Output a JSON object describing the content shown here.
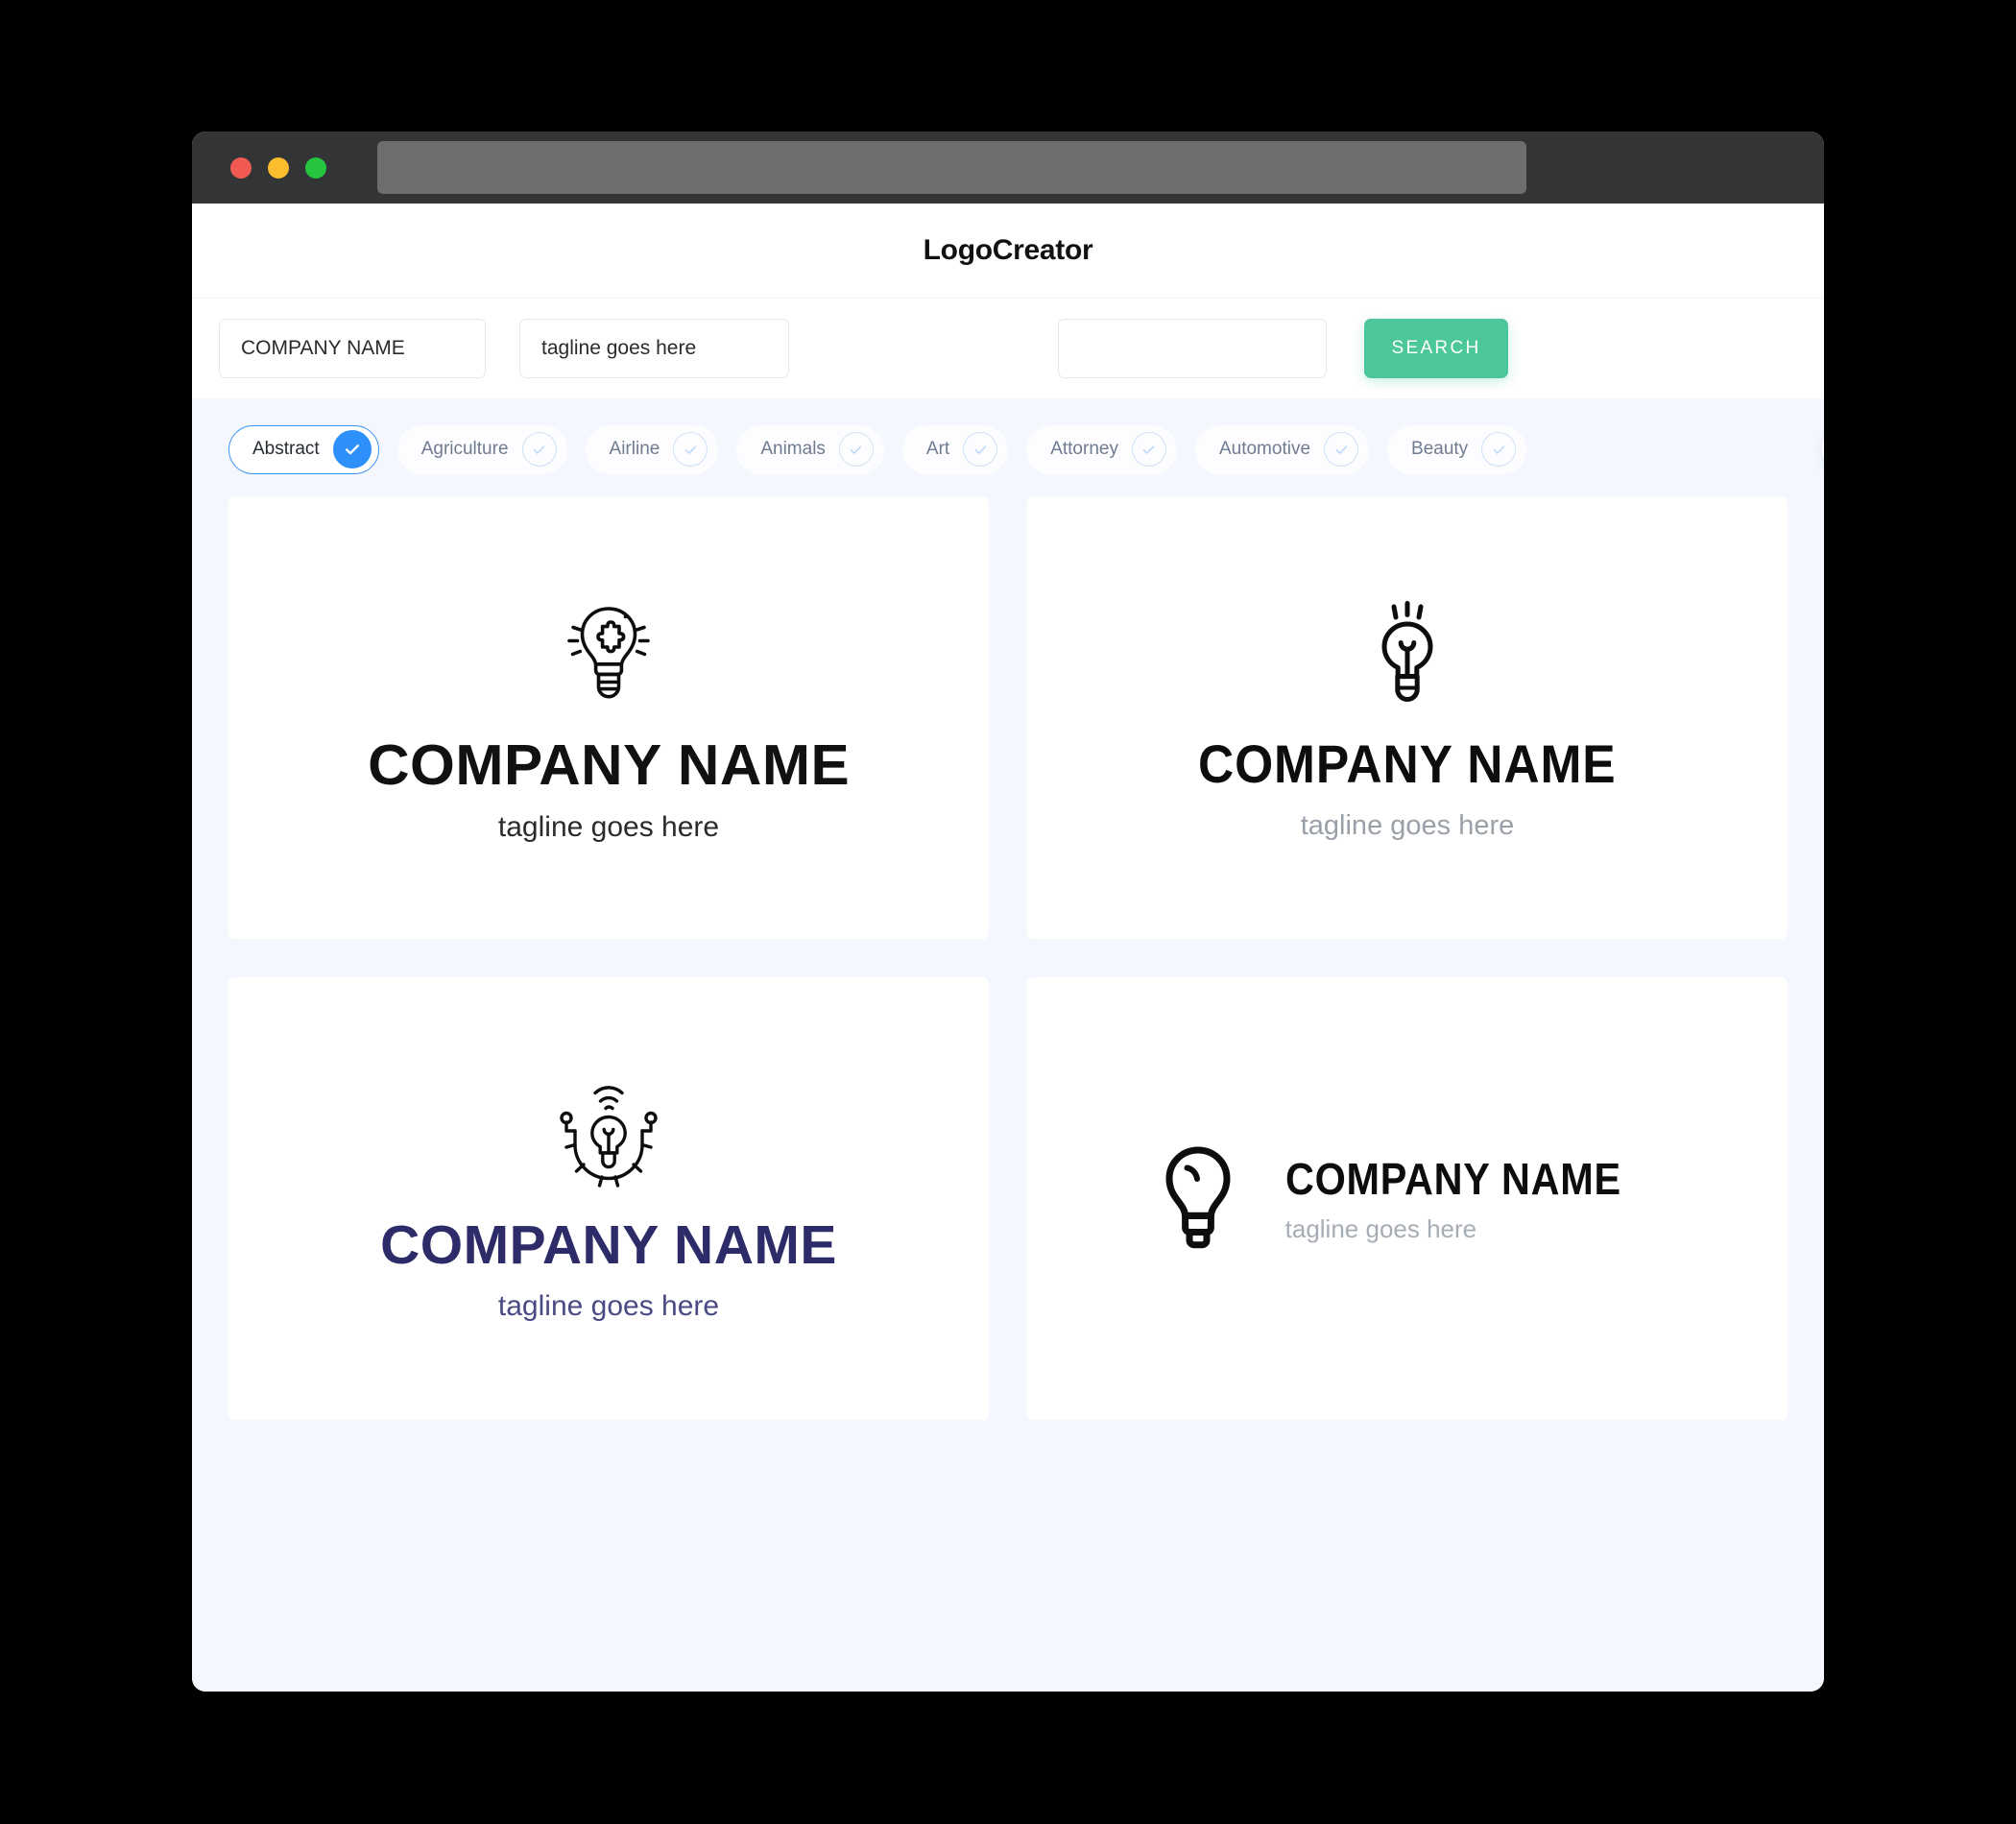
{
  "window": {
    "traffic_lights": [
      {
        "name": "close",
        "color": "#F05A52"
      },
      {
        "name": "minimize",
        "color": "#FBBD2E"
      },
      {
        "name": "maximize",
        "color": "#25C53F"
      }
    ],
    "address_bar_value": ""
  },
  "header": {
    "title": "LogoCreator"
  },
  "search": {
    "company_name_value": "COMPANY NAME",
    "company_name_placeholder": "COMPANY NAME",
    "tagline_value": "tagline goes here",
    "tagline_placeholder": "tagline goes here",
    "keyword_value": "",
    "keyword_placeholder": "",
    "search_button_label": "SEARCH",
    "search_button_color": "#4BC79A"
  },
  "categories": {
    "next_icon": "arrow-right-icon",
    "accent_color": "#2E90FA",
    "items": [
      {
        "label": "Abstract",
        "selected": true
      },
      {
        "label": "Agriculture",
        "selected": false
      },
      {
        "label": "Airline",
        "selected": false
      },
      {
        "label": "Animals",
        "selected": false
      },
      {
        "label": "Art",
        "selected": false
      },
      {
        "label": "Attorney",
        "selected": false
      },
      {
        "label": "Automotive",
        "selected": false
      },
      {
        "label": "Beauty",
        "selected": false
      }
    ]
  },
  "logos": [
    {
      "icon": "lightbulb-puzzle-icon",
      "name": "COMPANY NAME",
      "tagline": "tagline goes here",
      "name_color": "#111111",
      "tagline_color": "#2b2b2b",
      "layout": "stacked"
    },
    {
      "icon": "lightbulb-filament-icon",
      "name": "COMPANY NAME",
      "tagline": "tagline goes here",
      "name_color": "#0d0d0d",
      "tagline_color": "#9AA0A8",
      "layout": "stacked"
    },
    {
      "icon": "lightbulb-gear-wifi-icon",
      "name": "COMPANY NAME",
      "tagline": "tagline goes here",
      "name_color": "#2D2B68",
      "tagline_color": "#4A4A84",
      "layout": "stacked"
    },
    {
      "icon": "lightbulb-outline-icon",
      "name": "COMPANY NAME",
      "tagline": "tagline goes here",
      "name_color": "#0d0d0d",
      "tagline_color": "#A7ADB5",
      "layout": "horizontal"
    }
  ]
}
